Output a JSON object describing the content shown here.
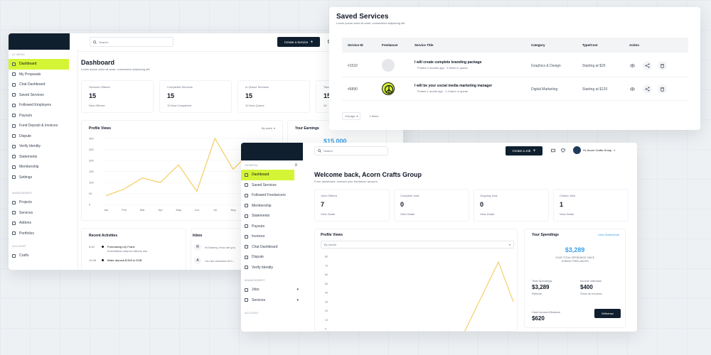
{
  "w1": {
    "sidebar_head": "LE MENU",
    "sidebar": [
      "Dashboard",
      "My Proposals",
      "Chat Dashboard",
      "Saved Services",
      "Followed Employers",
      "Payouts",
      "Fund Deposit & Invoices",
      "Dispute",
      "Verify Identity",
      "Statements",
      "Membership",
      "Settings"
    ],
    "section_manage": "MANAGEMENT",
    "manage": [
      "Projects",
      "Services",
      "Addons",
      "Portfolios"
    ],
    "section_account": "ACCOUNT",
    "account": [
      "Crafts"
    ],
    "search_placeholder": "Search...",
    "create_label": "Create a Service",
    "title": "Dashboard",
    "subtitle": "Lorem ipsum dolor sit amet, consectetur adipiscing elit.",
    "stats": [
      {
        "label": "Services Offered",
        "value": "15",
        "sub": "New Offered"
      },
      {
        "label": "Completed Services",
        "value": "15",
        "sub": "10 New Completed"
      },
      {
        "label": "In Queue Services",
        "value": "15",
        "sub": "10 New Queue"
      },
      {
        "label": "Tota",
        "value": "15",
        "sub": "10"
      }
    ],
    "profile_views": "Profile Views",
    "period": "By week",
    "your_earnings": "Your Earnings",
    "earnings_value": "$15,000",
    "recent_activities": "Recent Activities",
    "inbox": "Inbox",
    "activities": [
      {
        "time": "8:45",
        "title": "Purchasing Lily Frank",
        "sub": "Exercitation ullamco laboris nisi"
      },
      {
        "time": "10:45",
        "title": "Make deposit $ 800 to ESB",
        "sub": ""
      }
    ],
    "messages": [
      {
        "initial": "R",
        "text": "Hi Sammy, How are you"
      },
      {
        "initial": "A",
        "text": "You are welcome at C..."
      }
    ]
  },
  "chart1": {
    "type": "line",
    "categories": [
      "Jan",
      "Feb",
      "Mar",
      "Apr",
      "May",
      "Jun",
      "Jul",
      "Aug",
      "Sep",
      "Oct"
    ],
    "values": [
      40,
      70,
      120,
      100,
      180,
      60,
      300,
      160,
      240,
      210
    ],
    "ylim": [
      0,
      300
    ],
    "yticks": [
      "300",
      "250",
      "200",
      "150",
      "100",
      "50",
      "0"
    ],
    "color": "#f5d06b"
  },
  "w2": {
    "title": "Saved Services",
    "subtitle": "Lorem ipsum dolor sit amet, consectetur adipiscing elit.",
    "columns": [
      "Service ID",
      "Freelancer",
      "Service Title",
      "Category",
      "Type/Cost",
      "Action"
    ],
    "rows": [
      {
        "id": "#1532",
        "title": "I will create complete branding package",
        "meta": "Posted 2 months ago   0 Items in queue",
        "category": "Graphics & Design",
        "cost": "Starting at $25"
      },
      {
        "id": "#6890",
        "title": "I will be your social media marketing manager",
        "meta": "Posted 1 month ago   1 Orders in queue",
        "category": "Digital Marketing",
        "cost": "Starting at $120"
      }
    ],
    "per_page": "10/page",
    "pages": "2 items"
  },
  "w3": {
    "search_placeholder": "Search",
    "create_label": "Create a Job",
    "user": "Hi, Acorn Crafts Group",
    "section_general": "GENERAL",
    "sidebar": [
      "Dashboard",
      "Saved Services",
      "Followed Freelancers",
      "Membership",
      "Statements",
      "Payouts",
      "Invoices",
      "Chat Dashboard",
      "Dispute",
      "Verify Identity"
    ],
    "section_manage": "MANAGEMENT",
    "manage": [
      "Jobs",
      "Services"
    ],
    "section_account": "ACCOUNT",
    "title": "Welcome back, Acorn Crafts Group",
    "subtitle": "From dashboard, oversee your freelancer account.",
    "stats": [
      {
        "label": "Jobs Offered",
        "value": "7",
        "sub": "View Detail"
      },
      {
        "label": "Complete Jobs",
        "value": "0",
        "sub": "View Detail"
      },
      {
        "label": "Ongoing Jobs",
        "value": "0",
        "sub": "View Detail"
      },
      {
        "label": "Closed Jobs",
        "value": "1",
        "sub": "View Detail"
      }
    ],
    "profile_views": "Profile Views",
    "period": "By month",
    "spendings_title": "Your Spendings",
    "view_statement": "View Statements",
    "spend_value": "$3,289",
    "spend_caption1": "YOUR TOTAL SPENDINGS SINCE",
    "spend_caption2": "JOINING FREELANCER",
    "total_spend_label": "Total Spendings",
    "total_spend_value": "$3,289",
    "total_spend_sub": "Refresh",
    "income_label": "Income withdraw",
    "income_value": "$400",
    "income_sub": "Show all invoices",
    "cash_label": "Cash Account Balance",
    "cash_value": "$620",
    "withdraw_label": "Withdraw"
  },
  "chart2": {
    "type": "line",
    "yticks": [
      "80",
      "70",
      "60",
      "50",
      "40",
      "30",
      "20",
      "10",
      "0"
    ],
    "color": "#f5d06b"
  }
}
